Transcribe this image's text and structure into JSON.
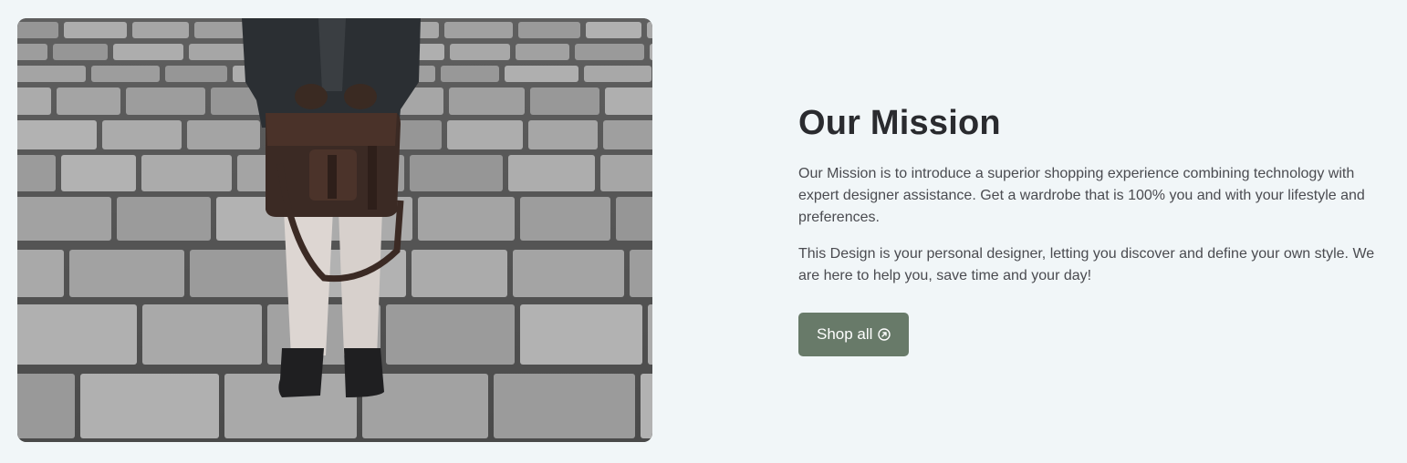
{
  "hero_image": {
    "subject": "Person in a dark jacket holding a brown leather messenger bag on stone stairs"
  },
  "mission": {
    "title": "Our Mission",
    "paragraph_1": "Our Mission is to introduce a superior shopping experience combining technology with expert designer assistance. Get a wardrobe that is 100% you and with your lifestyle and preferences.",
    "paragraph_2": "This Design is your personal designer, letting you discover and define your own style. We are here to help you, save time and your day!",
    "button_label": "Shop all",
    "button_icon": "arrow-up-right-circle-icon"
  },
  "colors": {
    "page_background": "#f1f6f8",
    "button_background": "#687a69",
    "title_text": "#2a2b2f",
    "body_text": "#4a4b50"
  }
}
